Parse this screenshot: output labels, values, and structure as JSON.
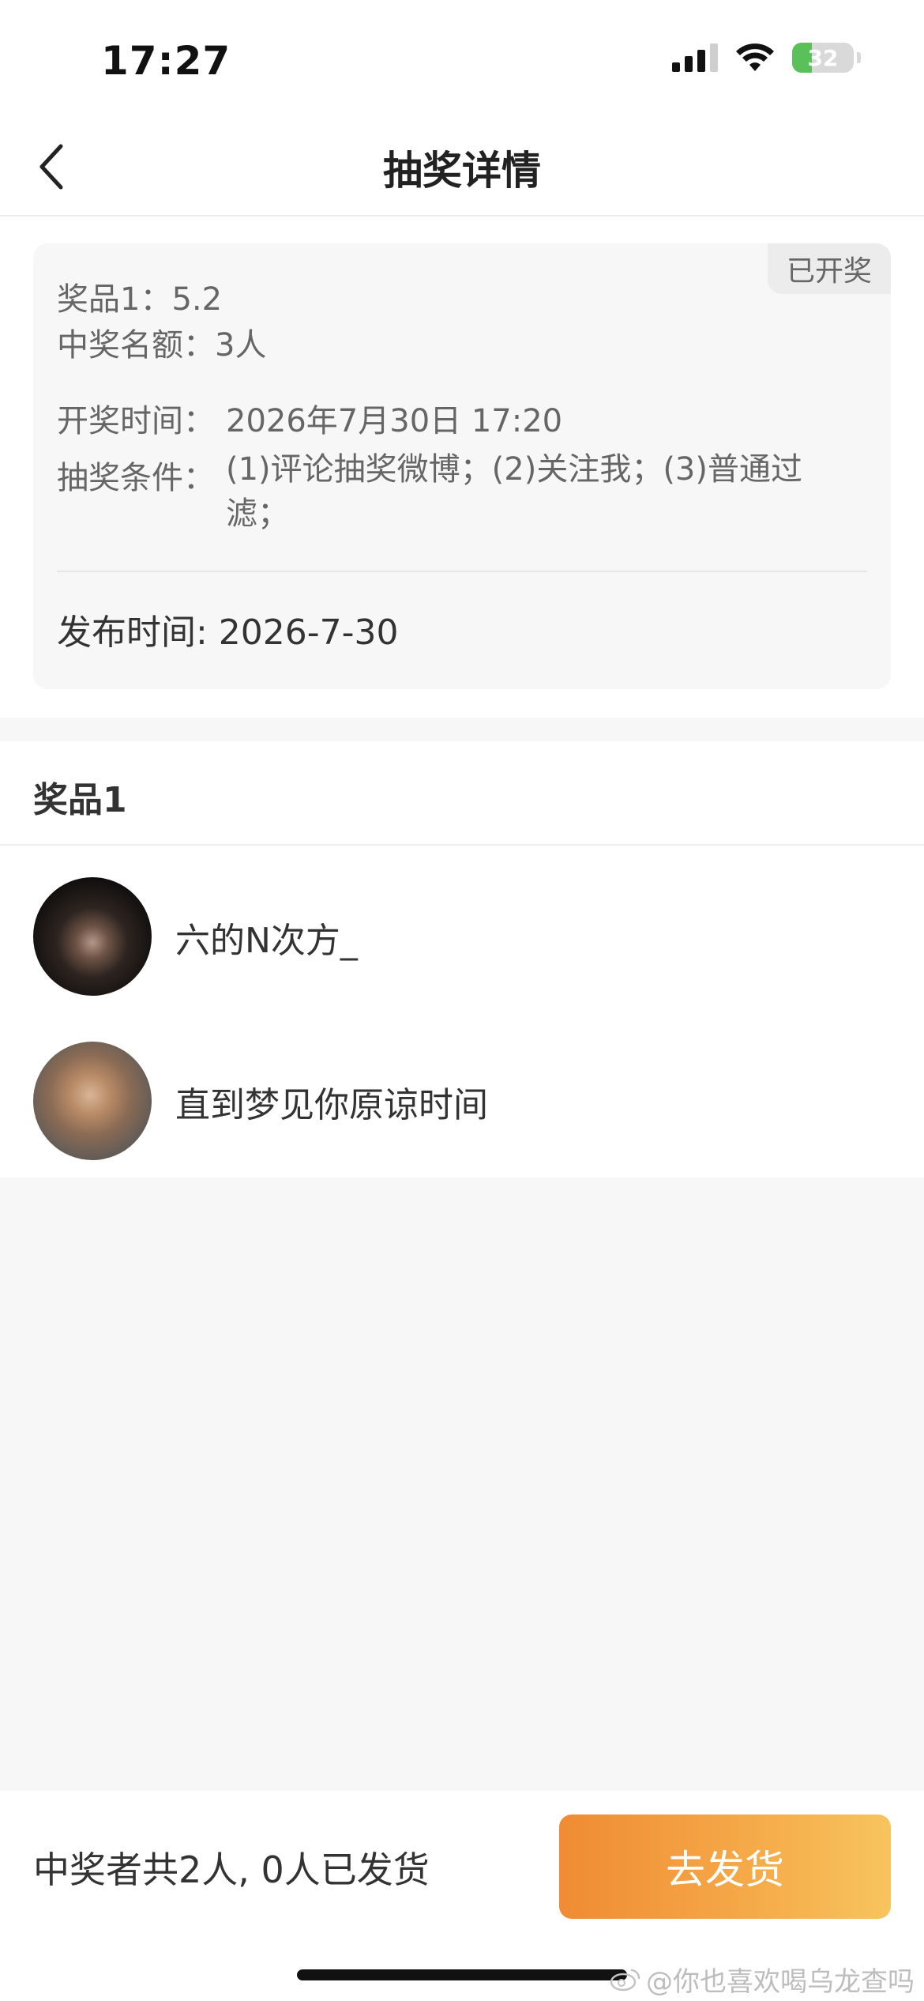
{
  "status_bar": {
    "time": "17:27",
    "battery_level": "32",
    "battery_fraction": 0.32,
    "icons": [
      "signal-icon",
      "wifi-icon",
      "battery-icon"
    ]
  },
  "nav": {
    "title": "抽奖详情",
    "back_icon": "chevron-left-icon"
  },
  "info": {
    "status_tag": "已开奖",
    "prize_line": "奖品1：5.2",
    "quota_line": "中奖名额：3人",
    "draw_time_label": "开奖时间：",
    "draw_time_value": "2026年7月30日 17:20",
    "conditions_label": "抽奖条件：",
    "conditions_value": "(1)评论抽奖微博；(2)关注我；(3)普通过滤；",
    "publish_line": "发布时间: 2026-7-30"
  },
  "prize_section": {
    "title": "奖品1",
    "winners": [
      {
        "name": "六的N次方_"
      },
      {
        "name": "直到梦见你原谅时间"
      }
    ]
  },
  "bottom_bar": {
    "summary": "中奖者共2人, 0人已发货",
    "ship_button": "去发货"
  },
  "watermark": {
    "text": "@你也喜欢喝乌龙查吗",
    "icon": "weibo-icon"
  },
  "colors": {
    "button_gradient_start": "#ef8b34",
    "button_gradient_end": "#f7c45e",
    "page_bg": "#f7f7f7",
    "battery_green": "#5ac05a"
  }
}
